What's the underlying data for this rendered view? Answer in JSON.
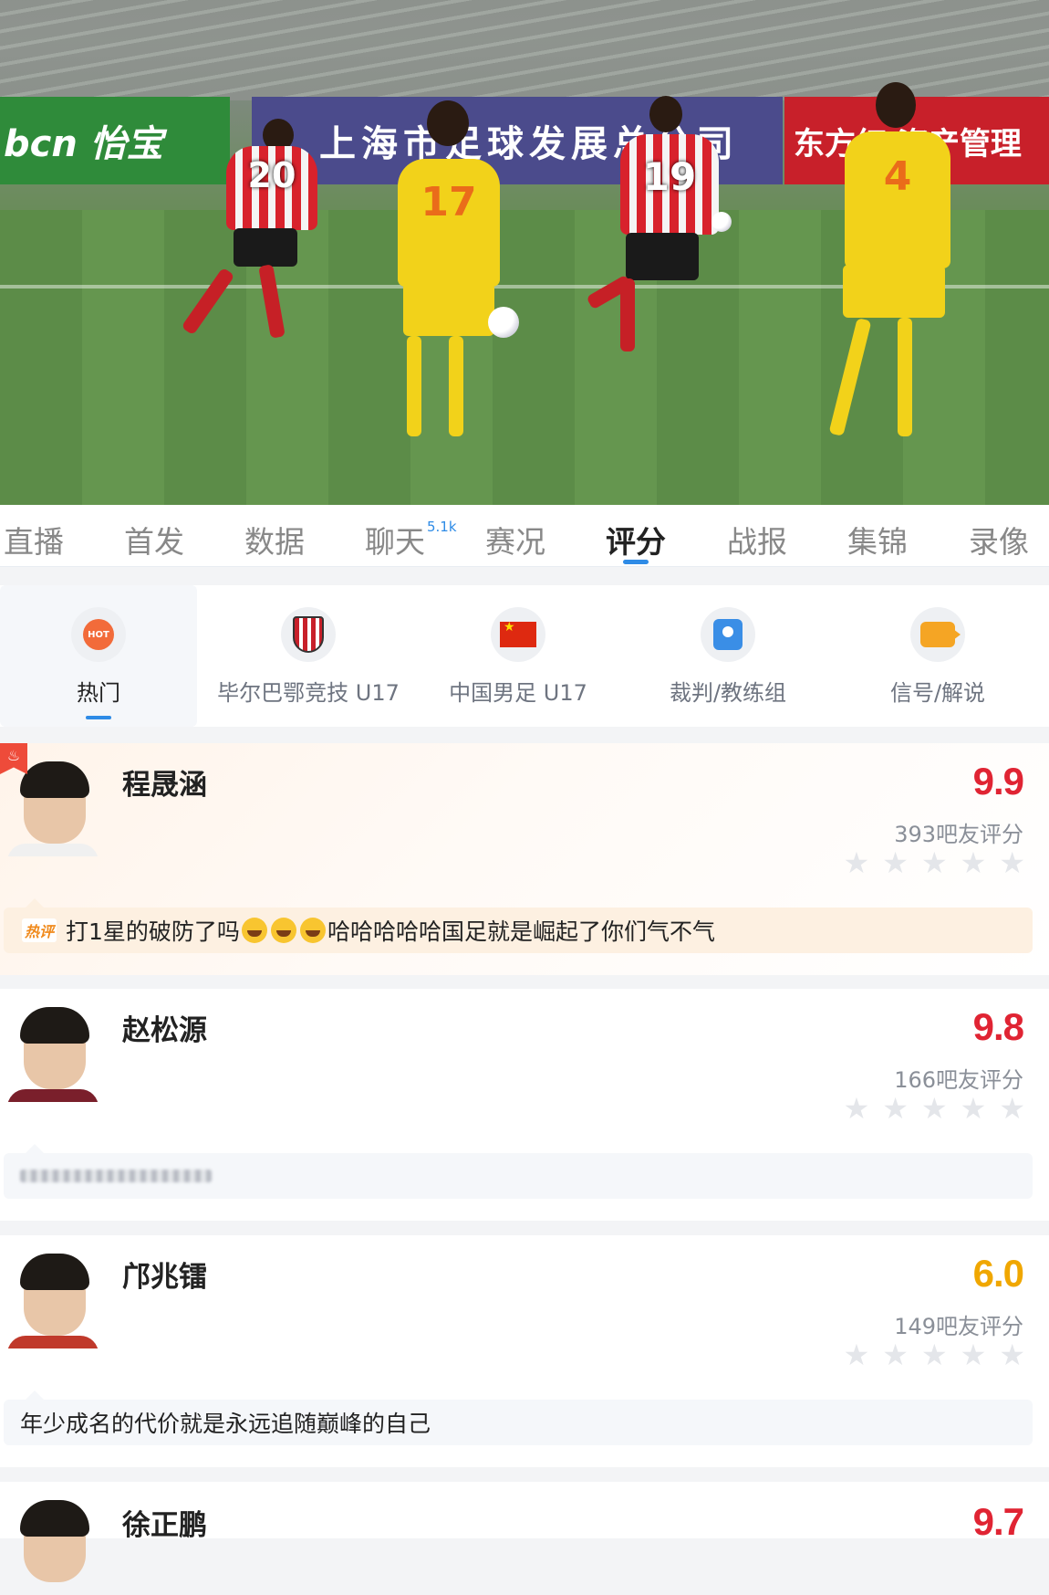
{
  "video": {
    "boards": {
      "green": "bcn 怡宝",
      "purple": "上海市足球发展总公司",
      "red": "东方红 资产管理"
    },
    "jerseys": [
      "20",
      "17",
      "19",
      "4"
    ]
  },
  "tabs": [
    {
      "label": "直播"
    },
    {
      "label": "首发"
    },
    {
      "label": "数据"
    },
    {
      "label": "聊天",
      "badge": "5.1k"
    },
    {
      "label": "赛况"
    },
    {
      "label": "评分",
      "active": true
    },
    {
      "label": "战报"
    },
    {
      "label": "集锦"
    },
    {
      "label": "录像"
    }
  ],
  "filters": [
    {
      "label": "热门",
      "icon": "hot-icon",
      "active": true,
      "icon_text": "HOT"
    },
    {
      "label": "毕尔巴鄂竞技 U17",
      "icon": "athletic-bilbao-crest-icon"
    },
    {
      "label": "中国男足 U17",
      "icon": "china-flag-icon"
    },
    {
      "label": "裁判/教练组",
      "icon": "referee-icon"
    },
    {
      "label": "信号/解说",
      "icon": "signal-icon"
    }
  ],
  "players": [
    {
      "name": "程晟涵",
      "score": "9.9",
      "score_color": "#e02433",
      "votes": "393吧友评分",
      "hot": true,
      "comment_tag": "热评",
      "comment_pre": "打1星的破防了吗",
      "comment_post": "哈哈哈哈哈国足就是崛起了你们气不气",
      "shirt_color": "#ffffff"
    },
    {
      "name": "赵松源",
      "score": "9.8",
      "score_color": "#e02433",
      "votes": "166吧友评分",
      "comment_blurred": true,
      "shirt_color": "#7a1f2b"
    },
    {
      "name": "邝兆镭",
      "score": "6.0",
      "score_color": "#f0a700",
      "votes": "149吧友评分",
      "comment": "年少成名的代价就是永远追随巅峰的自己",
      "shirt_color": "#c0392b"
    },
    {
      "name": "徐正鹏",
      "score": "9.7",
      "score_color": "#e02433"
    }
  ]
}
